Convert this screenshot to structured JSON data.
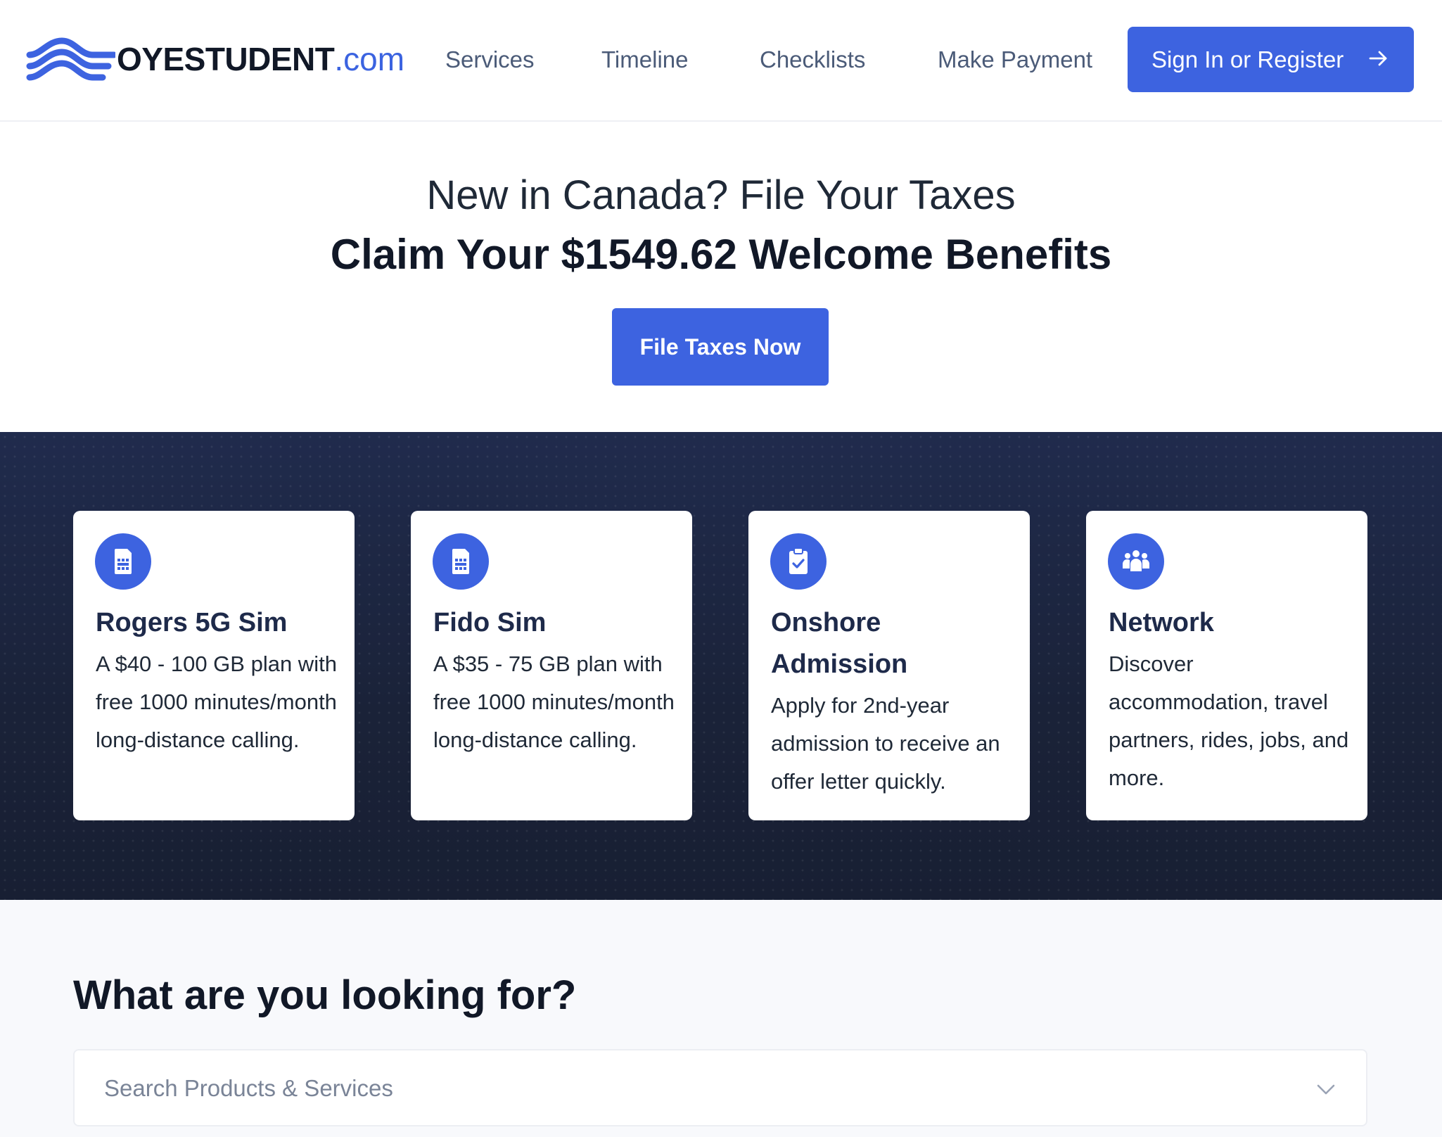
{
  "header": {
    "logo_text": "OYESTUDENT",
    "logo_tld": ".com",
    "nav": [
      "Services",
      "Timeline",
      "Checklists",
      "Make Payment"
    ],
    "signin_label": "Sign In or Register"
  },
  "hero": {
    "subtitle": "New in Canada? File Your Taxes",
    "title": "Claim Your $1549.62 Welcome Benefits",
    "cta_label": "File Taxes Now"
  },
  "cards": [
    {
      "icon": "sim-card-icon",
      "title": "Rogers 5G Sim",
      "description": "A $40 - 100 GB plan with free 1000 minutes/month long-distance calling."
    },
    {
      "icon": "sim-card-icon",
      "title": "Fido Sim",
      "description": "A $35 - 75 GB plan with free 1000 minutes/month long-distance calling."
    },
    {
      "icon": "clipboard-check-icon",
      "title": "Onshore Admission",
      "description": "Apply for 2nd-year admission to receive an offer letter quickly."
    },
    {
      "icon": "people-group-icon",
      "title": "Network",
      "description": "Discover accommodation, travel partners, rides, jobs, and more."
    }
  ],
  "search": {
    "heading": "What are you looking for?",
    "placeholder": "Search Products & Services"
  },
  "colors": {
    "accent": "#3d63e0",
    "band_background": "#1c2540",
    "nav_text": "#4b5b78"
  }
}
